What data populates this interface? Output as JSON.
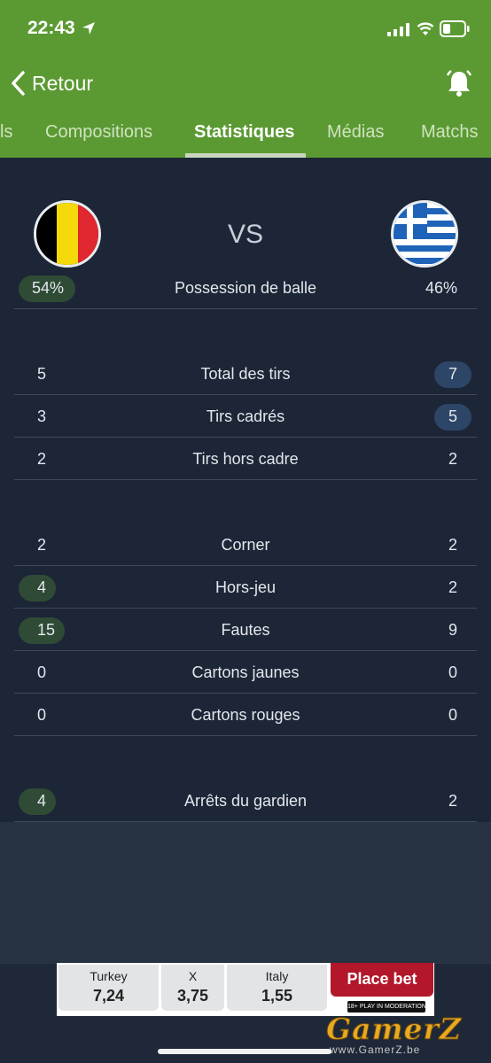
{
  "status_bar": {
    "time": "22:43"
  },
  "nav": {
    "back_label": "Retour"
  },
  "tabs": [
    {
      "label": "ls",
      "active": false
    },
    {
      "label": "Compositions",
      "active": false
    },
    {
      "label": "Statistiques",
      "active": true
    },
    {
      "label": "Médias",
      "active": false
    },
    {
      "label": "Matchs",
      "active": false
    }
  ],
  "match": {
    "vs_label": "VS"
  },
  "stats": [
    {
      "label": "Possession de balle",
      "home": "54%",
      "away": "46%",
      "highlight": "home"
    },
    {
      "label": "Total des tirs",
      "home": "5",
      "away": "7",
      "highlight": "away"
    },
    {
      "label": "Tirs cadrés",
      "home": "3",
      "away": "5",
      "highlight": "away"
    },
    {
      "label": "Tirs hors cadre",
      "home": "2",
      "away": "2",
      "highlight": "none"
    },
    {
      "label": "Corner",
      "home": "2",
      "away": "2",
      "highlight": "none"
    },
    {
      "label": "Hors-jeu",
      "home": "4",
      "away": "2",
      "highlight": "home"
    },
    {
      "label": "Fautes",
      "home": "15",
      "away": "9",
      "highlight": "home"
    },
    {
      "label": "Cartons jaunes",
      "home": "0",
      "away": "0",
      "highlight": "none"
    },
    {
      "label": "Cartons rouges",
      "home": "0",
      "away": "0",
      "highlight": "none"
    },
    {
      "label": "Arrêts du gardien",
      "home": "4",
      "away": "2",
      "highlight": "home"
    }
  ],
  "ad": {
    "cells": [
      {
        "name": "Turkey",
        "odds": "7,24"
      },
      {
        "name": "X",
        "odds": "3,75"
      },
      {
        "name": "Italy",
        "odds": "1,55"
      }
    ],
    "cta": "Place bet",
    "disclaimer": "18+ PLAY IN MODERATION"
  },
  "watermark": {
    "brand": "GamerZ",
    "url": "www.GamerZ.be"
  },
  "colors": {
    "header_green": "#5b9a33",
    "home_pill": "#2f4b36",
    "away_pill": "#2d4566",
    "bet_red": "#b2172b",
    "belgium": [
      "#000000",
      "#f5d90a",
      "#e0262e"
    ],
    "greece_blue": "#1f63b8"
  },
  "icons": [
    "location-arrow-icon",
    "signal-icon",
    "wifi-icon",
    "battery-icon",
    "chevron-left-icon",
    "bell-icon"
  ]
}
